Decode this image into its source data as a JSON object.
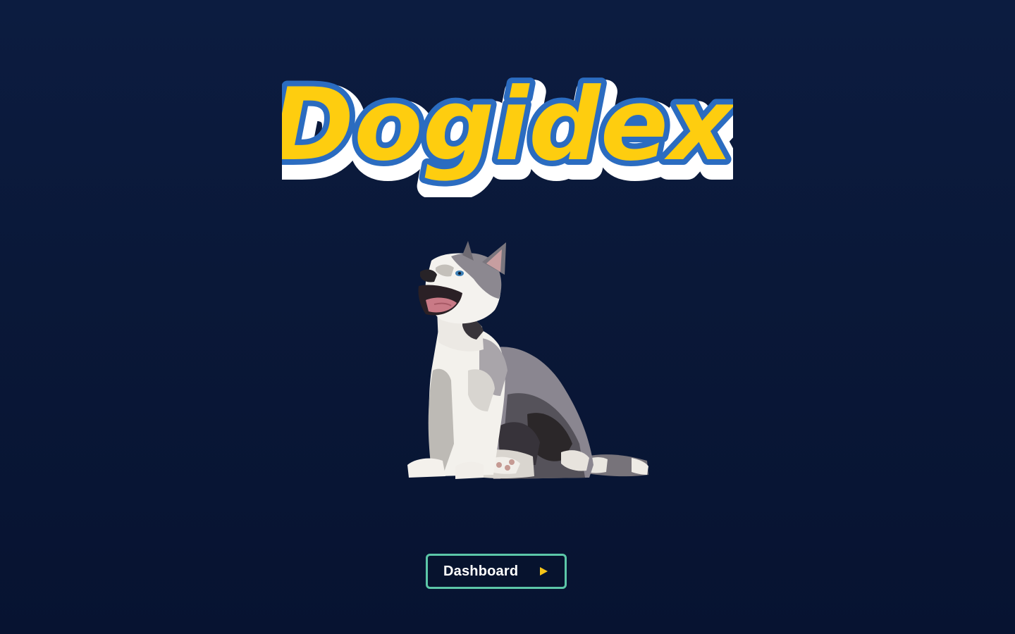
{
  "app": {
    "logo_text": "Dogidex"
  },
  "hero": {
    "image_subject": "husky-puppy"
  },
  "actions": {
    "dashboard_label": "Dashboard",
    "dashboard_icon": "play-icon"
  },
  "colors": {
    "background": "#0a1838",
    "logo_fill": "#fecd0f",
    "logo_outline": "#2b6cc0",
    "logo_shadow": "#ffffff",
    "button_border": "#5cc7a8",
    "button_icon": "#f5c518"
  }
}
